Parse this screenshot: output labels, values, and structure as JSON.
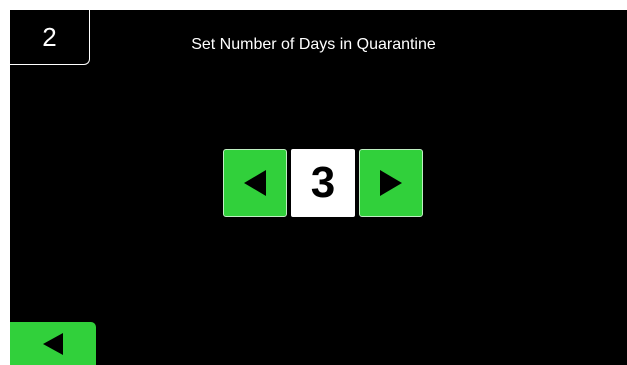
{
  "header": {
    "step_number": "2",
    "title": "Set Number of Days in Quarantine"
  },
  "stepper": {
    "value": "3",
    "decrement_icon": "triangle-left-icon",
    "increment_icon": "triangle-right-icon"
  },
  "footer": {
    "back_icon": "triangle-left-icon"
  },
  "colors": {
    "background": "#000000",
    "accent_green": "#31d03b",
    "text": "#ffffff",
    "value_box": "#ffffff"
  }
}
